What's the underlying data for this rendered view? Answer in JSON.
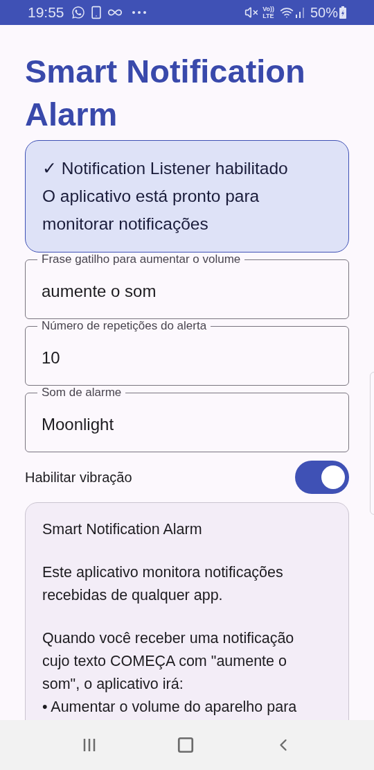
{
  "status_bar": {
    "time": "19:55",
    "volte": [
      "Vo))",
      "LTE"
    ],
    "battery": "50%"
  },
  "title": "Smart Notification Alarm",
  "status_card": {
    "lines": [
      "✓ Notification Listener habilitado",
      "O aplicativo está pronto para monitorar notificações"
    ]
  },
  "fields": [
    {
      "label": "Frase gatilho para aumentar o volume",
      "value": "aumente o som"
    },
    {
      "label": "Número de repetições do alerta",
      "value": "10"
    },
    {
      "label": "Som de alarme",
      "value": "Moonlight"
    }
  ],
  "vibration": {
    "label": "Habilitar vibração",
    "on": true
  },
  "info_card": {
    "paragraphs": [
      "Smart Notification Alarm",
      "Este aplicativo monitora notificações recebidas de qualquer app.",
      "Quando você receber uma notificação cujo texto COMEÇA com \"aumente o som\", o aplicativo irá:\n• Aumentar o volume do aparelho para"
    ]
  }
}
